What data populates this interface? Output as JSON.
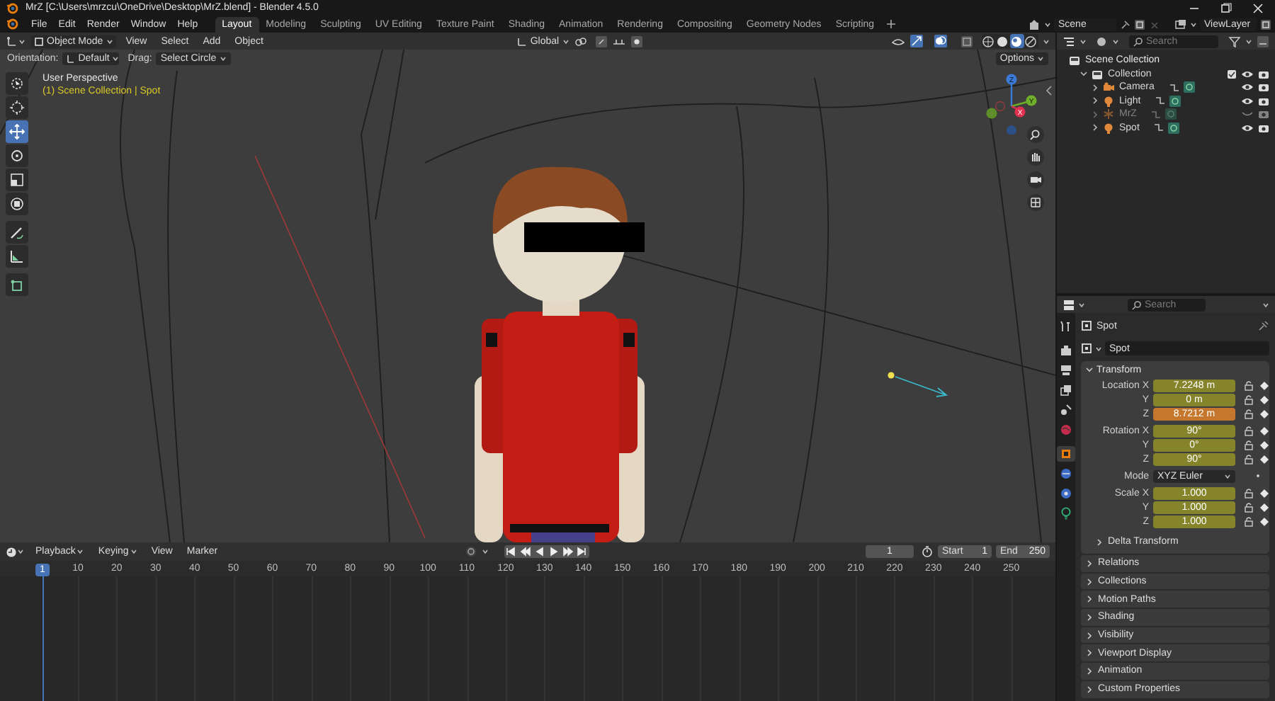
{
  "window": {
    "title": "MrZ [C:\\Users\\mrzcu\\OneDrive\\Desktop\\MrZ.blend] - Blender 4.5.0"
  },
  "menu": [
    "File",
    "Edit",
    "Render",
    "Window",
    "Help"
  ],
  "workspaces": [
    {
      "label": "Layout",
      "selected": true
    },
    {
      "label": "Modeling",
      "selected": false
    },
    {
      "label": "Sculpting",
      "selected": false
    },
    {
      "label": "UV Editing",
      "selected": false
    },
    {
      "label": "Texture Paint",
      "selected": false
    },
    {
      "label": "Shading",
      "selected": false
    },
    {
      "label": "Animation",
      "selected": false
    },
    {
      "label": "Rendering",
      "selected": false
    },
    {
      "label": "Compositing",
      "selected": false
    },
    {
      "label": "Geometry Nodes",
      "selected": false
    },
    {
      "label": "Scripting",
      "selected": false
    }
  ],
  "scene": {
    "name": "Scene",
    "view_layer": "ViewLayer"
  },
  "viewport": {
    "header": {
      "mode": "Object Mode",
      "menus": [
        "View",
        "Select",
        "Add",
        "Object"
      ],
      "orientation": "Global"
    },
    "shading": [
      {
        "kind": "wireframe",
        "selected": false
      },
      {
        "kind": "solid",
        "selected": false
      },
      {
        "kind": "material",
        "selected": true
      },
      {
        "kind": "rendered",
        "selected": false
      }
    ],
    "tool_settings": {
      "orientation_label": "Orientation:",
      "orientation": "Default",
      "drag_label": "Drag:",
      "drag": "Select Circle",
      "options": "Options"
    },
    "tools": [
      {
        "kind": "tweak",
        "selected": false
      },
      {
        "kind": "cursor",
        "selected": false
      },
      {
        "kind": "move",
        "selected": true
      },
      {
        "kind": "rotate",
        "selected": false
      },
      {
        "kind": "scale",
        "selected": false
      },
      {
        "kind": "transform",
        "selected": false
      },
      {
        "kind": "annotate",
        "selected": false
      },
      {
        "kind": "measure",
        "selected": false
      },
      {
        "kind": "add_cube",
        "selected": false
      }
    ],
    "overlay": {
      "view": "User Perspective",
      "context": "(1) Scene Collection | Spot"
    },
    "gizmo": {
      "axes": [
        "Z",
        "Y",
        "X"
      ]
    }
  },
  "outliner": {
    "search_placeholder": "Search",
    "tree": [
      {
        "label": "Scene Collection",
        "kind": "scene_collection",
        "children": [
          {
            "label": "Collection",
            "kind": "collection",
            "expanded": true,
            "visible": true,
            "children": [
              {
                "label": "Camera",
                "kind": "camera",
                "expanded": false,
                "visible": true
              },
              {
                "label": "Light",
                "kind": "light",
                "expanded": false,
                "visible": true
              },
              {
                "label": "MrZ",
                "kind": "armature",
                "expanded": false,
                "visible": false
              },
              {
                "label": "Spot",
                "kind": "light",
                "expanded": false,
                "visible": true
              }
            ]
          }
        ]
      }
    ]
  },
  "properties": {
    "search_placeholder": "Search",
    "tabs": [
      {
        "kind": "tool",
        "selected": false
      },
      {
        "kind": "render",
        "selected": false
      },
      {
        "kind": "output",
        "selected": false
      },
      {
        "kind": "view_layer",
        "selected": false
      },
      {
        "kind": "scene",
        "selected": false
      },
      {
        "kind": "world",
        "selected": false
      },
      {
        "kind": "object",
        "selected": true
      },
      {
        "kind": "constraints",
        "selected": false
      },
      {
        "kind": "physics",
        "selected": false
      },
      {
        "kind": "light_data",
        "selected": false
      }
    ],
    "context": "Spot",
    "object_name": "Spot",
    "transform": {
      "label": "Transform",
      "expanded": true,
      "fields": [
        {
          "kind": "number",
          "label": "Location X",
          "value": "7.2248 m",
          "animated": true,
          "keyframe": false
        },
        {
          "kind": "number",
          "label": "Y",
          "value": "0 m",
          "animated": true,
          "keyframe": false
        },
        {
          "kind": "number",
          "label": "Z",
          "value": "8.7212 m",
          "animated": true,
          "keyframe": true
        },
        {
          "kind": "number",
          "label": "Rotation X",
          "value": "90°",
          "animated": true,
          "keyframe": false
        },
        {
          "kind": "number",
          "label": "Y",
          "value": "0°",
          "animated": true,
          "keyframe": false
        },
        {
          "kind": "number",
          "label": "Z",
          "value": "90°",
          "animated": true,
          "keyframe": false
        },
        {
          "kind": "dropdown",
          "label": "Mode",
          "value": "XYZ Euler"
        },
        {
          "kind": "number",
          "label": "Scale X",
          "value": "1.000",
          "animated": true,
          "keyframe": false
        },
        {
          "kind": "number",
          "label": "Y",
          "value": "1.000",
          "animated": true,
          "keyframe": false
        },
        {
          "kind": "number",
          "label": "Z",
          "value": "1.000",
          "animated": true,
          "keyframe": false
        }
      ],
      "subpanels": [
        {
          "label": "Delta Transform",
          "expanded": false
        }
      ]
    },
    "panels": [
      {
        "label": "Relations",
        "expanded": false
      },
      {
        "label": "Collections",
        "expanded": false
      },
      {
        "label": "Motion Paths",
        "expanded": false
      },
      {
        "label": "Shading",
        "expanded": false
      },
      {
        "label": "Visibility",
        "expanded": false
      },
      {
        "label": "Viewport Display",
        "expanded": false
      },
      {
        "label": "Animation",
        "expanded": false
      },
      {
        "label": "Custom Properties",
        "expanded": false
      }
    ]
  },
  "timeline": {
    "menus": [
      "Playback",
      "Keying",
      "View",
      "Marker"
    ],
    "current_frame": "1",
    "start_label": "Start",
    "start": "1",
    "end_label": "End",
    "end": "250",
    "ruler": [
      {
        "label": "1",
        "current": true
      },
      {
        "label": "10",
        "current": false
      },
      {
        "label": "20",
        "current": false
      },
      {
        "label": "30",
        "current": false
      },
      {
        "label": "40",
        "current": false
      },
      {
        "label": "50",
        "current": false
      },
      {
        "label": "60",
        "current": false
      },
      {
        "label": "70",
        "current": false
      },
      {
        "label": "80",
        "current": false
      },
      {
        "label": "90",
        "current": false
      },
      {
        "label": "100",
        "current": false
      },
      {
        "label": "110",
        "current": false
      },
      {
        "label": "120",
        "current": false
      },
      {
        "label": "130",
        "current": false
      },
      {
        "label": "140",
        "current": false
      },
      {
        "label": "150",
        "current": false
      },
      {
        "label": "160",
        "current": false
      },
      {
        "label": "170",
        "current": false
      },
      {
        "label": "180",
        "current": false
      },
      {
        "label": "190",
        "current": false
      },
      {
        "label": "200",
        "current": false
      },
      {
        "label": "210",
        "current": false
      },
      {
        "label": "220",
        "current": false
      },
      {
        "label": "230",
        "current": false
      },
      {
        "label": "240",
        "current": false
      },
      {
        "label": "250",
        "current": false
      }
    ]
  }
}
